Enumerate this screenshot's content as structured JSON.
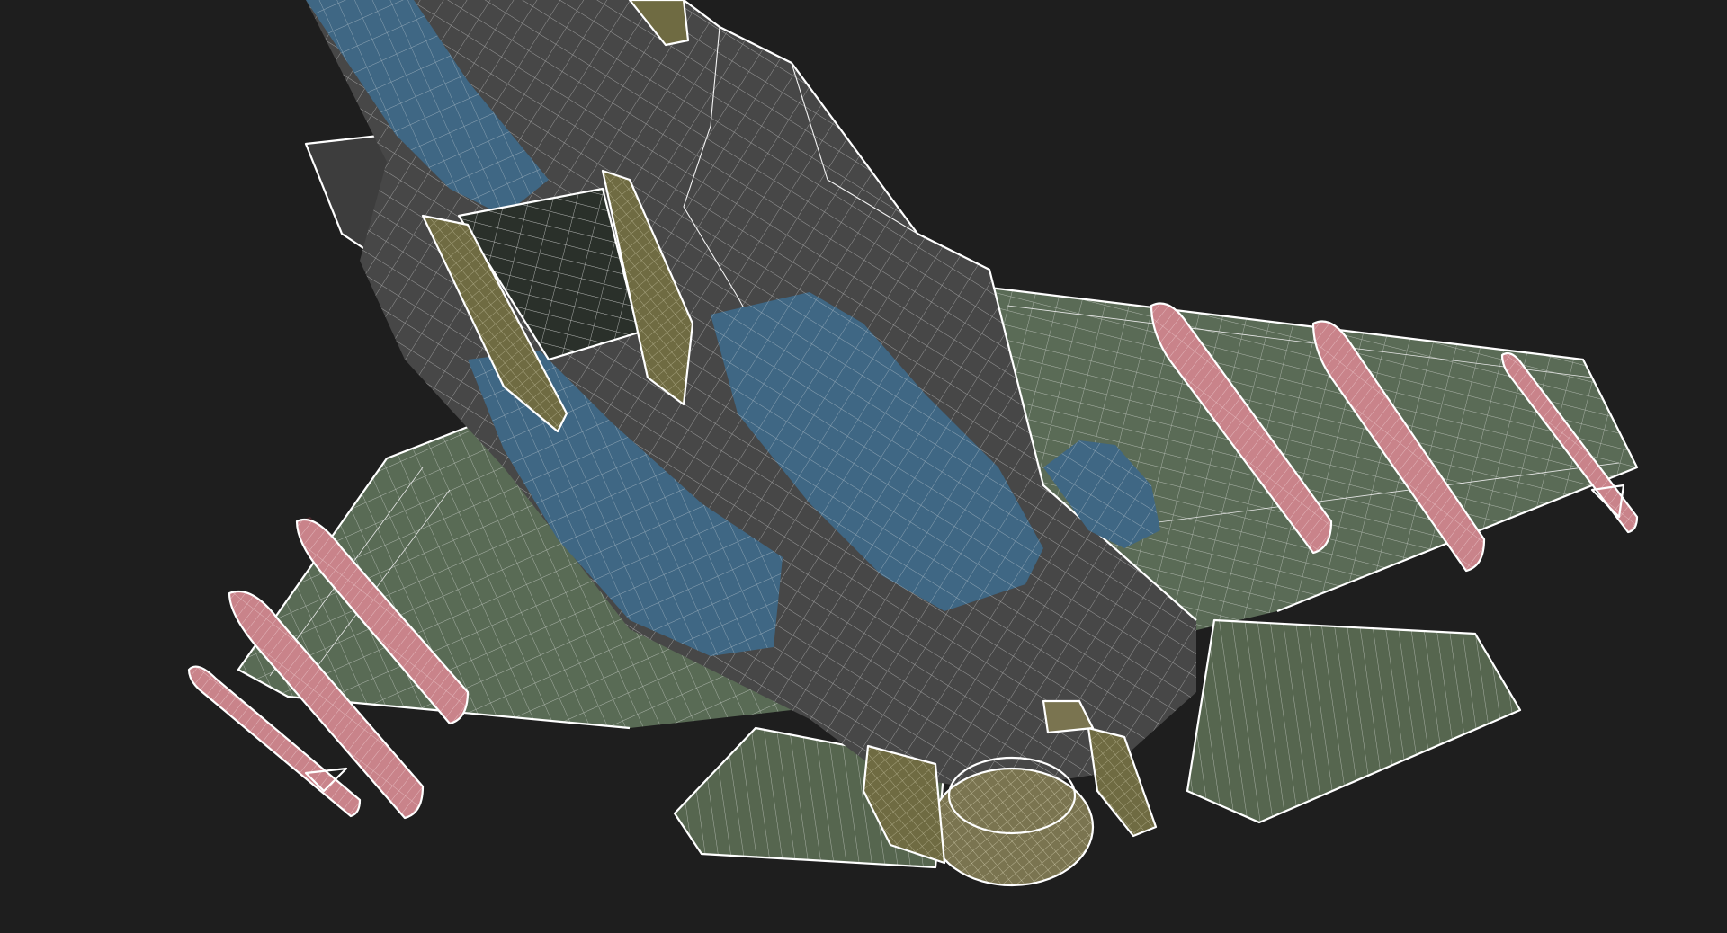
{
  "scene": {
    "subject": "wireframe-fighter-jet-underside",
    "background": "#1e1e1e",
    "colors": {
      "fuselage": "#4a4a4a",
      "fuselage_dark": "#3b3b3b",
      "intake_blue": "#3f6784",
      "wing_green": "#5a6b56",
      "tail_green": "#56664f",
      "bay_door_gold": "#6f6b42",
      "nozzle_gold": "#7a7450",
      "bomb_pink": "#c9838a",
      "bomb_shadow": "#4a2a2e",
      "wire": "#f4f4f4"
    }
  }
}
